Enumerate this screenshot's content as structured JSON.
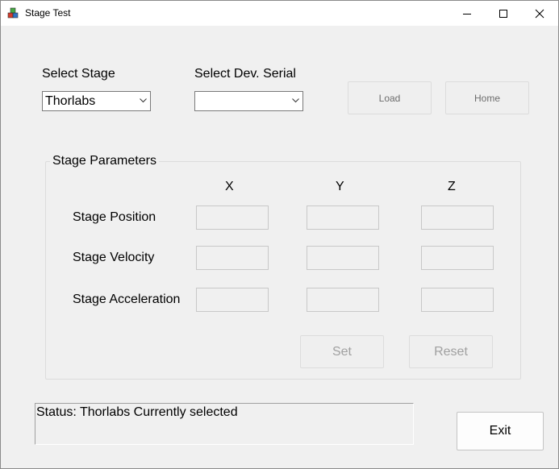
{
  "window": {
    "title": "Stage Test"
  },
  "selection": {
    "stage_label": "Select Stage",
    "stage_value": "Thorlabs",
    "serial_label": "Select Dev. Serial",
    "serial_value": ""
  },
  "actions": {
    "load_label": "Load",
    "home_label": "Home"
  },
  "parameters": {
    "group_title": "Stage Parameters",
    "axes": [
      "X",
      "Y",
      "Z"
    ],
    "rows": [
      {
        "label": "Stage Position",
        "values": [
          "",
          "",
          ""
        ]
      },
      {
        "label": "Stage Velocity",
        "values": [
          "",
          "",
          ""
        ]
      },
      {
        "label": "Stage Acceleration",
        "values": [
          "",
          "",
          ""
        ]
      }
    ],
    "set_label": "Set",
    "reset_label": "Reset"
  },
  "status": {
    "text": "Status: Thorlabs Currently selected"
  },
  "exit_label": "Exit"
}
